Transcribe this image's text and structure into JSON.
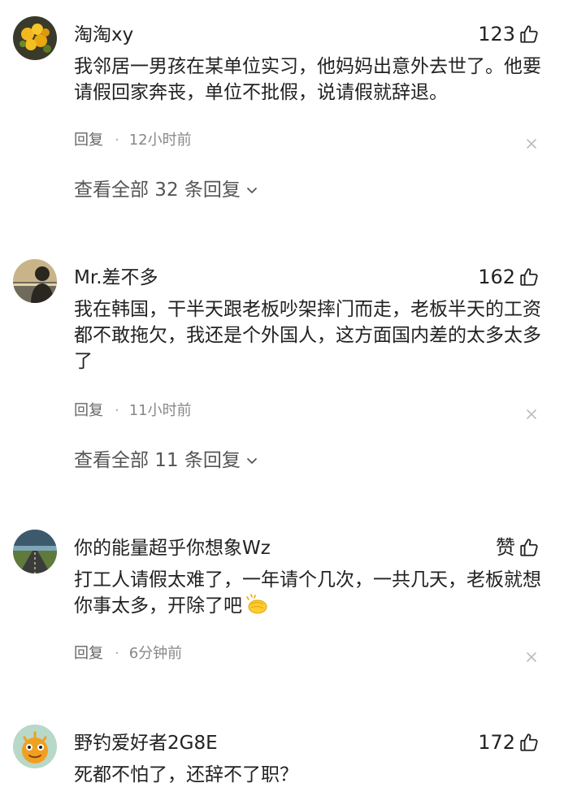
{
  "comments": [
    {
      "username": "淘淘xy",
      "likes": "123",
      "text": "我邻居一男孩在某单位实习，他妈妈出意外去世了。他要请假回家奔丧，单位不批假，说请假就辞退。",
      "reply_label": "回复",
      "separator": "·",
      "time": "12小时前",
      "view_all": "查看全部 32 条回复",
      "avatar": "yellow-flowers"
    },
    {
      "username": "Mr.差不多",
      "likes": "162",
      "text": "我在韩国，干半天跟老板吵架摔门而走，老板半天的工资都不敢拖欠，我还是个外国人，这方面国内差的太多太多了",
      "reply_label": "回复",
      "separator": "·",
      "time": "11小时前",
      "view_all": "查看全部 11 条回复",
      "avatar": "silhouette-sea"
    },
    {
      "username": "你的能量超乎你想象Wz",
      "likes": "赞",
      "text": "打工人请假太难了，一年请个几次，一共几天，老板就想你事太多，开除了吧",
      "emoji": "clapping-hands-emoji",
      "reply_label": "回复",
      "separator": "·",
      "time": "6分钟前",
      "avatar": "road-landscape"
    },
    {
      "username": "野钓爱好者2G8E",
      "likes": "172",
      "text": "死都不怕了，还辞不了职？",
      "avatar": "cartoon-creature"
    }
  ],
  "icons": {
    "like": "thumbs-up-icon",
    "close": "close-icon",
    "expand": "chevron-down-icon"
  },
  "colors": {
    "text": "#222222",
    "meta": "#888888",
    "view_all": "#555555"
  }
}
